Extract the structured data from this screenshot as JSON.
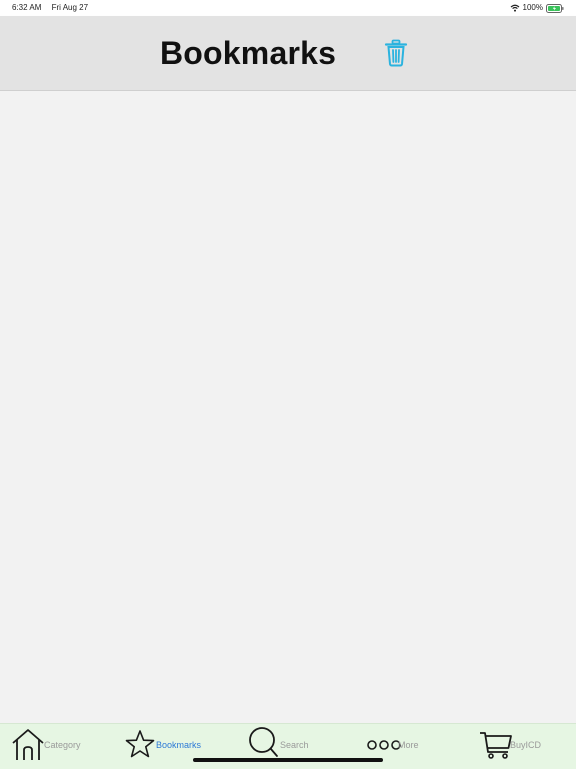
{
  "status_bar": {
    "time": "6:32 AM",
    "date": "Fri Aug 27",
    "battery": "100%"
  },
  "header": {
    "title": "Bookmarks",
    "trash_icon": "trash-icon"
  },
  "tab_bar": {
    "active": "bookmarks",
    "items": [
      {
        "id": "category",
        "label": "Category",
        "icon": "house-icon"
      },
      {
        "id": "bookmarks",
        "label": "Bookmarks",
        "icon": "star-icon"
      },
      {
        "id": "search",
        "label": "Search",
        "icon": "search-icon"
      },
      {
        "id": "more",
        "label": "More",
        "icon": "more-dots-icon"
      },
      {
        "id": "buyicd",
        "label": "BuyICD",
        "icon": "cart-icon"
      }
    ]
  },
  "colors": {
    "accent": "#2d7ad6",
    "trash_icon": "#2bb3df",
    "tab_bar_background": "#e6f6e3",
    "header_background": "#e3e3e3",
    "page_background": "#f2f2f2",
    "battery_fill": "#39c25a"
  }
}
